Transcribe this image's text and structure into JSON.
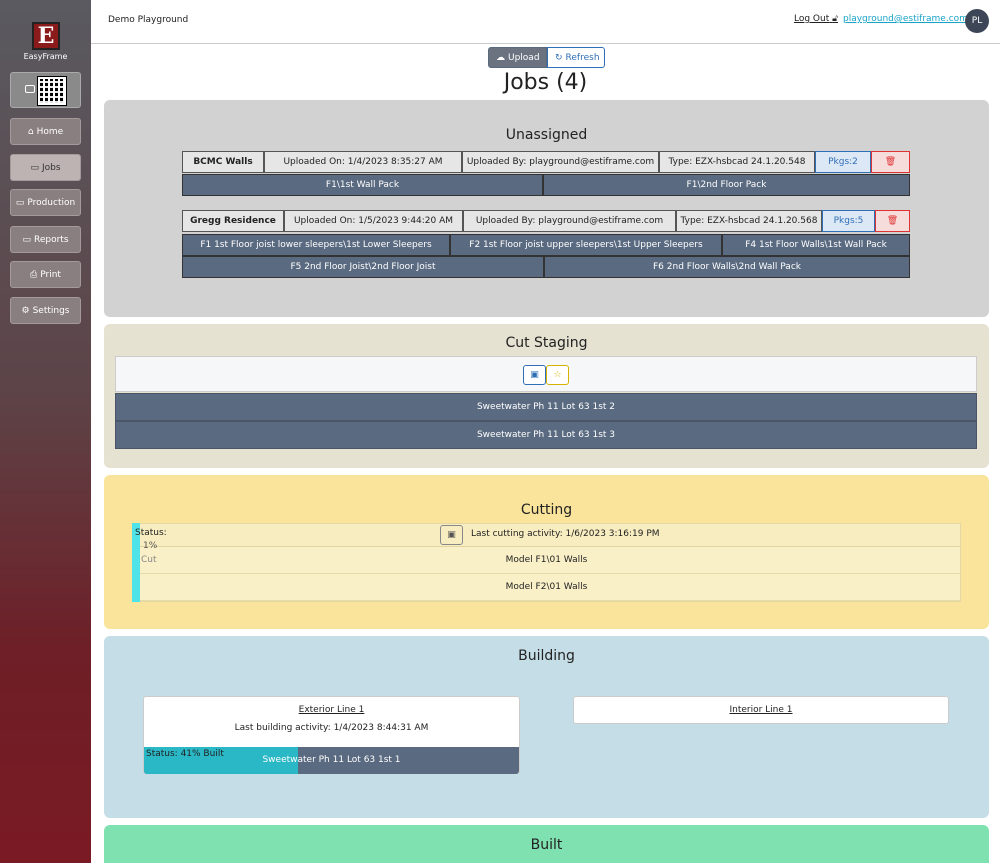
{
  "app": {
    "logo_letter": "E",
    "logo_name": "EasyFrame",
    "title": "Demo Playground"
  },
  "header": {
    "logout_label": "Log Out",
    "email": "playground@estiframe.com",
    "avatar_initials": "PL"
  },
  "sidebar": {
    "items": [
      {
        "label": "Home",
        "icon": "house-icon"
      },
      {
        "label": "Jobs",
        "icon": "briefcase-icon",
        "active": true
      },
      {
        "label": "Production",
        "icon": "monitor-icon"
      },
      {
        "label": "Reports",
        "icon": "monitor-icon"
      },
      {
        "label": "Print",
        "icon": "printer-icon"
      },
      {
        "label": "Settings",
        "icon": "gear-icon"
      }
    ]
  },
  "toolbar": {
    "upload_label": "Upload",
    "refresh_label": "Refresh"
  },
  "page": {
    "title": "Jobs (4)"
  },
  "unassigned": {
    "title": "Unassigned",
    "jobs": [
      {
        "name": "BCMC Walls",
        "uploaded_on": "Uploaded On: 1/4/2023 8:35:27 AM",
        "uploaded_by": "Uploaded By: playground@estiframe.com",
        "type": "Type: EZX-hsbcad 24.1.20.548",
        "pkgs": "Pkgs:2",
        "packages": [
          "F1\\1st Wall Pack",
          "F1\\2nd Floor Pack"
        ]
      },
      {
        "name": "Gregg Residence",
        "uploaded_on": "Uploaded On: 1/5/2023 9:44:20 AM",
        "uploaded_by": "Uploaded By: playground@estiframe.com",
        "type": "Type: EZX-hsbcad 24.1.20.568",
        "pkgs": "Pkgs:5",
        "packages": [
          "F1 1st Floor joist lower sleepers\\1st Lower Sleepers",
          "F2 1st Floor joist upper sleepers\\1st Upper Sleepers",
          "F4 1st Floor Walls\\1st Wall Pack",
          "F5 2nd Floor Joist\\2nd Floor Joist",
          "F6 2nd Floor Walls\\2nd Wall Pack"
        ]
      }
    ]
  },
  "staging": {
    "title": "Cut Staging",
    "rows": [
      "Sweetwater Ph 11 Lot 63 1st 2",
      "Sweetwater Ph 11 Lot 63 1st 3"
    ]
  },
  "cutting": {
    "title": "Cutting",
    "status_label": "Status:",
    "percent": "1%",
    "cut_label": "Cut",
    "progress": 0.01,
    "last_activity": "Last cutting activity: 1/6/2023 3:16:19 PM",
    "rows": [
      "Model F1\\01 Walls",
      "Model F2\\01 Walls"
    ]
  },
  "building": {
    "title": "Building",
    "lines": [
      {
        "name": "Exterior Line 1",
        "last_activity": "Last building activity: 1/4/2023 8:44:31 AM",
        "status": "Status: 41% Built",
        "progress": 0.41,
        "job": "Sweetwater Ph 11 Lot 63 1st 1"
      },
      {
        "name": "Interior Line 1"
      }
    ]
  },
  "built": {
    "title": "Built"
  },
  "colors": {
    "accent": "#1aa3c8",
    "sidebar_bottom": "#7a1a24",
    "package_row": "#5a6a80",
    "cutting_bg": "#fae49c",
    "building_bg": "#c5dde6",
    "built_bg": "#7fe1b0"
  }
}
